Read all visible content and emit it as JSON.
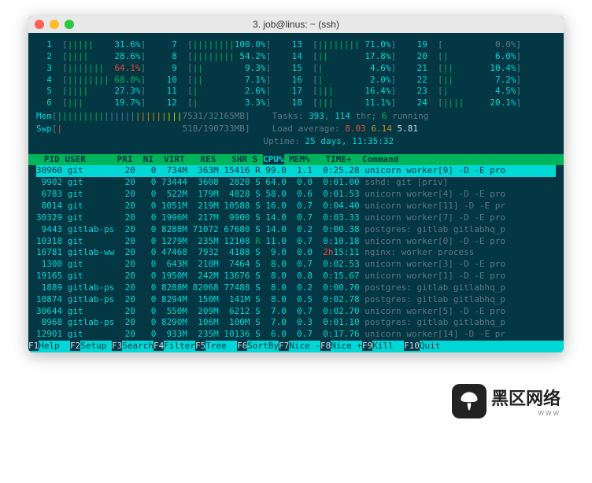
{
  "window": {
    "title": "3. job@linus: ~ (ssh)"
  },
  "cpu_meters": [
    [
      {
        "n": "1",
        "bars": "|||||",
        "pct": "31.6%",
        "c": "cyan"
      },
      {
        "n": "7",
        "bars": "||||||||",
        "pct": "100.0%",
        "c": "cyan"
      },
      {
        "n": "13",
        "bars": "||||||||",
        "pct": "71.0%",
        "c": "cyan"
      },
      {
        "n": "19",
        "bars": "",
        "pct": "0.0%",
        "c": "dim"
      }
    ],
    [
      {
        "n": "2",
        "bars": "||||",
        "pct": "28.6%",
        "c": "cyan"
      },
      {
        "n": "8",
        "bars": "||||||||",
        "pct": "54.2%",
        "c": "cyan"
      },
      {
        "n": "14",
        "bars": "||",
        "pct": "17.8%",
        "c": "cyan"
      },
      {
        "n": "20",
        "bars": "|",
        "pct": "6.0%",
        "c": "cyan"
      }
    ],
    [
      {
        "n": "3",
        "bars": "|||||||",
        "pct": "64.1%",
        "c": "red"
      },
      {
        "n": "9",
        "bars": "||",
        "pct": "9.3%",
        "c": "cyan"
      },
      {
        "n": "15",
        "bars": "|",
        "pct": "4.6%",
        "c": "cyan"
      },
      {
        "n": "21",
        "bars": "||",
        "pct": "10.4%",
        "c": "cyan"
      }
    ],
    [
      {
        "n": "4",
        "bars": "||||||||",
        "pct": "68.0%",
        "c": "green"
      },
      {
        "n": "10",
        "bars": "||",
        "pct": "7.1%",
        "c": "cyan"
      },
      {
        "n": "16",
        "bars": "|",
        "pct": "2.0%",
        "c": "cyan"
      },
      {
        "n": "22",
        "bars": "||",
        "pct": "7.2%",
        "c": "cyan"
      }
    ],
    [
      {
        "n": "5",
        "bars": "||||",
        "pct": "27.3%",
        "c": "cyan"
      },
      {
        "n": "11",
        "bars": "|",
        "pct": "2.6%",
        "c": "cyan"
      },
      {
        "n": "17",
        "bars": "|||",
        "pct": "16.4%",
        "c": "cyan"
      },
      {
        "n": "23",
        "bars": "|",
        "pct": "4.5%",
        "c": "cyan"
      }
    ],
    [
      {
        "n": "6",
        "bars": "|||",
        "pct": "19.7%",
        "c": "cyan"
      },
      {
        "n": "12",
        "bars": "|",
        "pct": "3.3%",
        "c": "cyan"
      },
      {
        "n": "18",
        "bars": "|||",
        "pct": "11.1%",
        "c": "cyan"
      },
      {
        "n": "24",
        "bars": "||||",
        "pct": "20.1%",
        "c": "cyan"
      }
    ]
  ],
  "mem": {
    "label": "Mem",
    "bars": "||||||||||||||||||||||||",
    "val": "7531/32165MB"
  },
  "swp": {
    "label": "Swp",
    "bars": "|",
    "val": "518/190733MB"
  },
  "tasks": {
    "line": "Tasks: 393, 114 thr; 6 running",
    "total": "393",
    "thr": "114",
    "run": "6"
  },
  "load": {
    "label": "Load average:",
    "v1": "8.03",
    "v2": "6.14",
    "v3": "5.81"
  },
  "uptime": {
    "label": "Uptime:",
    "val": "25 days, 11:35:32"
  },
  "columns": "  PID USER      PRI  NI  VIRT   RES   SHR S CPU% MEM%   TIME+  Command",
  "col_sort": "CPU%",
  "processes": [
    {
      "sel": true,
      "pid": "30960",
      "user": "git",
      "pri": "20",
      "ni": "0",
      "virt": "734M",
      "res": "363M",
      "shr": "15416",
      "s": "R",
      "cpu": "99.0",
      "mem": "1.1",
      "time": "0:25.28",
      "cmd": "unicorn worker[9] -D -E pro"
    },
    {
      "pid": "9902",
      "user": "git",
      "pri": "20",
      "ni": "0",
      "virt": "73444",
      "res": "3608",
      "shr": "2820",
      "s": "S",
      "cpu": "64.0",
      "mem": "0.0",
      "time": "0:01.00",
      "cmd": "sshd: git [priv]"
    },
    {
      "pid": "6783",
      "user": "git",
      "pri": "20",
      "ni": "0",
      "virt": "522M",
      "res": "179M",
      "shr": "4828",
      "s": "S",
      "cpu": "58.0",
      "mem": "0.6",
      "time": "0:01.53",
      "cmd": "unicorn worker[4] -D -E pro"
    },
    {
      "pid": "8014",
      "user": "git",
      "pri": "20",
      "ni": "0",
      "virt": "1051M",
      "res": "219M",
      "shr": "10588",
      "s": "S",
      "cpu": "16.0",
      "mem": "0.7",
      "time": "0:04.40",
      "cmd": "unicorn worker[11] -D -E pr"
    },
    {
      "pid": "30329",
      "user": "git",
      "pri": "20",
      "ni": "0",
      "virt": "1996M",
      "res": "217M",
      "shr": "9900",
      "s": "S",
      "cpu": "14.0",
      "mem": "0.7",
      "time": "0:03.33",
      "cmd": "unicorn worker[7] -D -E pro"
    },
    {
      "pid": "9443",
      "user": "gitlab-ps",
      "pri": "20",
      "ni": "0",
      "virt": "8288M",
      "res": "71072",
      "shr": "67680",
      "s": "S",
      "cpu": "14.0",
      "mem": "0.2",
      "time": "0:00.38",
      "cmd": "postgres: gitlab gitlabhq_p"
    },
    {
      "pid": "10318",
      "user": "git",
      "pri": "20",
      "ni": "0",
      "virt": "1279M",
      "res": "235M",
      "shr": "12108",
      "s": "R",
      "cpu": "11.0",
      "mem": "0.7",
      "time": "0:10.18",
      "cmd": "unicorn worker[0] -D -E pro",
      "run": true
    },
    {
      "pid": "16781",
      "user": "gitlab-ww",
      "pri": "20",
      "ni": "0",
      "virt": "47468",
      "res": "7932",
      "shr": "4188",
      "s": "S",
      "cpu": "9.0",
      "mem": "0.0",
      "time": "2h15:11",
      "cmd": "nginx: worker process",
      "tred": true
    },
    {
      "pid": "1300",
      "user": "git",
      "pri": "20",
      "ni": "0",
      "virt": "643M",
      "res": "210M",
      "shr": "7464",
      "s": "S",
      "cpu": "8.0",
      "mem": "0.7",
      "time": "0:02.53",
      "cmd": "unicorn worker[3] -D -E pro"
    },
    {
      "pid": "19165",
      "user": "git",
      "pri": "20",
      "ni": "0",
      "virt": "1950M",
      "res": "242M",
      "shr": "13676",
      "s": "S",
      "cpu": "8.0",
      "mem": "0.8",
      "time": "0:15.67",
      "cmd": "unicorn worker[1] -D -E pro"
    },
    {
      "pid": "1889",
      "user": "gitlab-ps",
      "pri": "20",
      "ni": "0",
      "virt": "8288M",
      "res": "82068",
      "shr": "77488",
      "s": "S",
      "cpu": "8.0",
      "mem": "0.2",
      "time": "0:00.70",
      "cmd": "postgres: gitlab gitlabhq_p"
    },
    {
      "pid": "10874",
      "user": "gitlab-ps",
      "pri": "20",
      "ni": "0",
      "virt": "8294M",
      "res": "150M",
      "shr": "141M",
      "s": "S",
      "cpu": "8.0",
      "mem": "0.5",
      "time": "0:02.78",
      "cmd": "postgres: gitlab gitlabhq_p"
    },
    {
      "pid": "30644",
      "user": "git",
      "pri": "20",
      "ni": "0",
      "virt": "550M",
      "res": "209M",
      "shr": "6212",
      "s": "S",
      "cpu": "7.0",
      "mem": "0.7",
      "time": "0:02.70",
      "cmd": "unicorn worker[5] -D -E pro"
    },
    {
      "pid": "8968",
      "user": "gitlab-ps",
      "pri": "20",
      "ni": "0",
      "virt": "8290M",
      "res": "106M",
      "shr": "100M",
      "s": "S",
      "cpu": "7.0",
      "mem": "0.3",
      "time": "0:01.10",
      "cmd": "postgres: gitlab gitlabhq_p"
    },
    {
      "pid": "12901",
      "user": "git",
      "pri": "20",
      "ni": "0",
      "virt": "933M",
      "res": "235M",
      "shr": "10136",
      "s": "S",
      "cpu": "6.0",
      "mem": "0.7",
      "time": "0:17.76",
      "cmd": "unicorn worker[14] -D -E pr"
    }
  ],
  "fkeys": [
    {
      "k": "F1",
      "l": "Help  "
    },
    {
      "k": "F2",
      "l": "Setup "
    },
    {
      "k": "F3",
      "l": "Search"
    },
    {
      "k": "F4",
      "l": "Filter"
    },
    {
      "k": "F5",
      "l": "Tree  "
    },
    {
      "k": "F6",
      "l": "SortBy"
    },
    {
      "k": "F7",
      "l": "Nice -"
    },
    {
      "k": "F8",
      "l": "Nice +"
    },
    {
      "k": "F9",
      "l": "Kill  "
    },
    {
      "k": "F10",
      "l": "Quit  "
    }
  ],
  "logo": {
    "text": "黑区网络",
    "sub": "WWW"
  }
}
